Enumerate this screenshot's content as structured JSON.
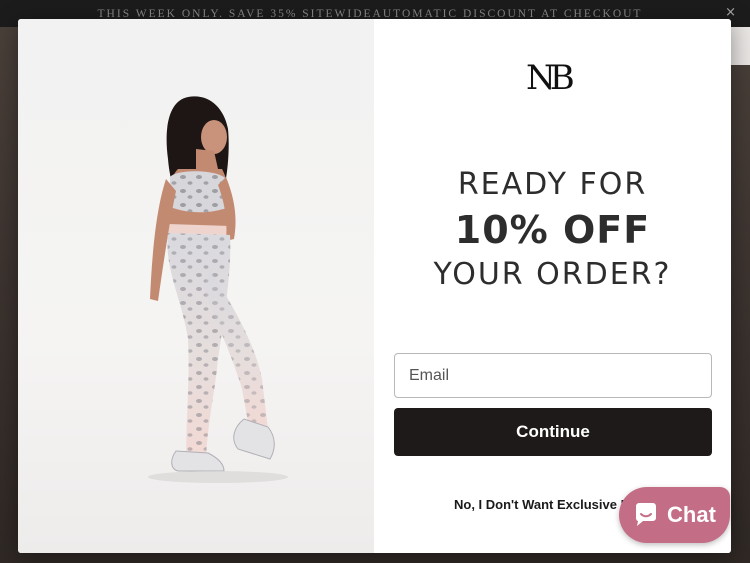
{
  "announcement": {
    "text": "THIS WEEK ONLY. SAVE 35% SITEWIDEAUTOMATIC DISCOUNT AT CHECKOUT",
    "close_icon": "×"
  },
  "popup": {
    "logo_text": "NB",
    "headline_line1": "READY FOR",
    "headline_line2": "10% OFF",
    "headline_line3": "YOUR ORDER?",
    "email_placeholder": "Email",
    "email_value": "",
    "continue_label": "Continue",
    "decline_label": "No, I Don't Want Exclusive Deals"
  },
  "chat": {
    "label": "Chat",
    "icon": "chat-bubble-icon"
  },
  "colors": {
    "primary_button": "#1f1a1a",
    "chat_button": "#c46d86",
    "announcement_bg": "#1c1c1c"
  }
}
